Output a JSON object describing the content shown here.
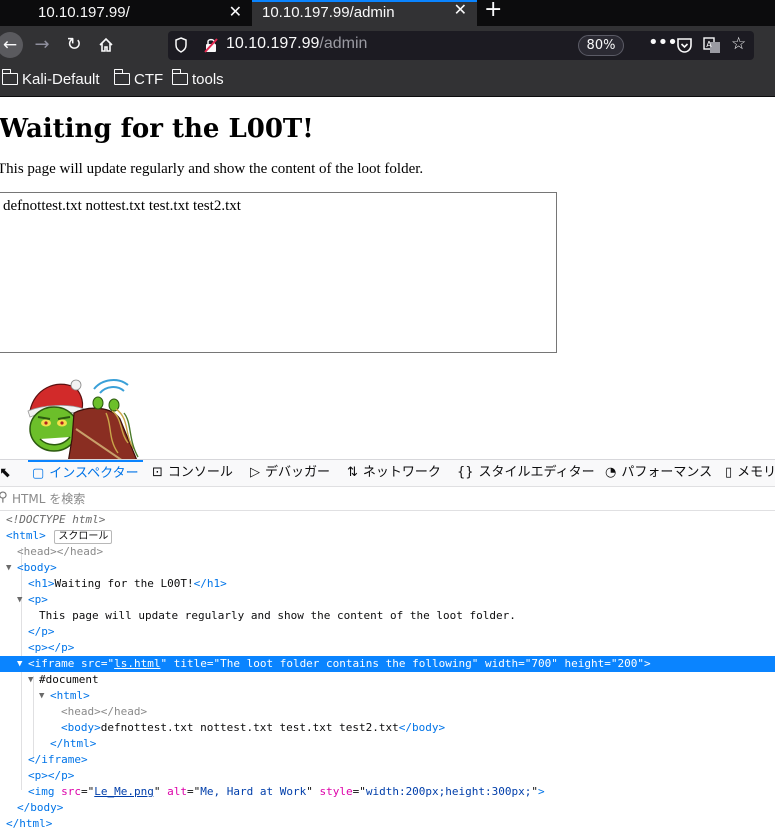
{
  "browser": {
    "tabs": [
      {
        "title": "10.10.197.99/",
        "active": false
      },
      {
        "title": "10.10.197.99/admin",
        "active": true
      }
    ],
    "new_tab": "+",
    "url_host": "10.10.197.99",
    "url_path": "/admin",
    "zoom": "80%",
    "bookmarks": [
      "Kali-Default",
      "CTF",
      "tools"
    ],
    "accent_color": "#0a84ff"
  },
  "page": {
    "heading": "Waiting for the L00T!",
    "paragraph": "This page will update regularly and show the content of the loot folder.",
    "iframe_content": "defnottest.txt nottest.txt test.txt test2.txt",
    "image_alt": "Me, Hard at Work"
  },
  "devtools": {
    "tabs": [
      {
        "label": "インスペクター",
        "icon": "inspector-icon",
        "active": true
      },
      {
        "label": "コンソール",
        "icon": "console-icon"
      },
      {
        "label": "デバッガー",
        "icon": "debugger-icon"
      },
      {
        "label": "ネットワーク",
        "icon": "network-icon"
      },
      {
        "label": "スタイルエディター",
        "icon": "style-editor-icon"
      },
      {
        "label": "パフォーマンス",
        "icon": "performance-icon"
      },
      {
        "label": "メモリ",
        "icon": "memory-icon"
      }
    ],
    "search_placeholder": "HTML を検索",
    "scroll_badge": "スクロール",
    "markup": {
      "doctype": "<!DOCTYPE html>",
      "h1_text": "Waiting for the L00T!",
      "p_text": "This page will update regularly and show the content of the loot folder.",
      "iframe_src": "ls.html",
      "iframe_title": "The loot folder contains the following",
      "iframe_width": "700",
      "iframe_height": "200",
      "document_label": "#document",
      "inner_body_text": "defnottest.txt nottest.txt test.txt test2.txt",
      "img_src": "Le_Me.png",
      "img_alt": "Me, Hard at Work",
      "img_style": "width:200px;height:300px;"
    }
  }
}
